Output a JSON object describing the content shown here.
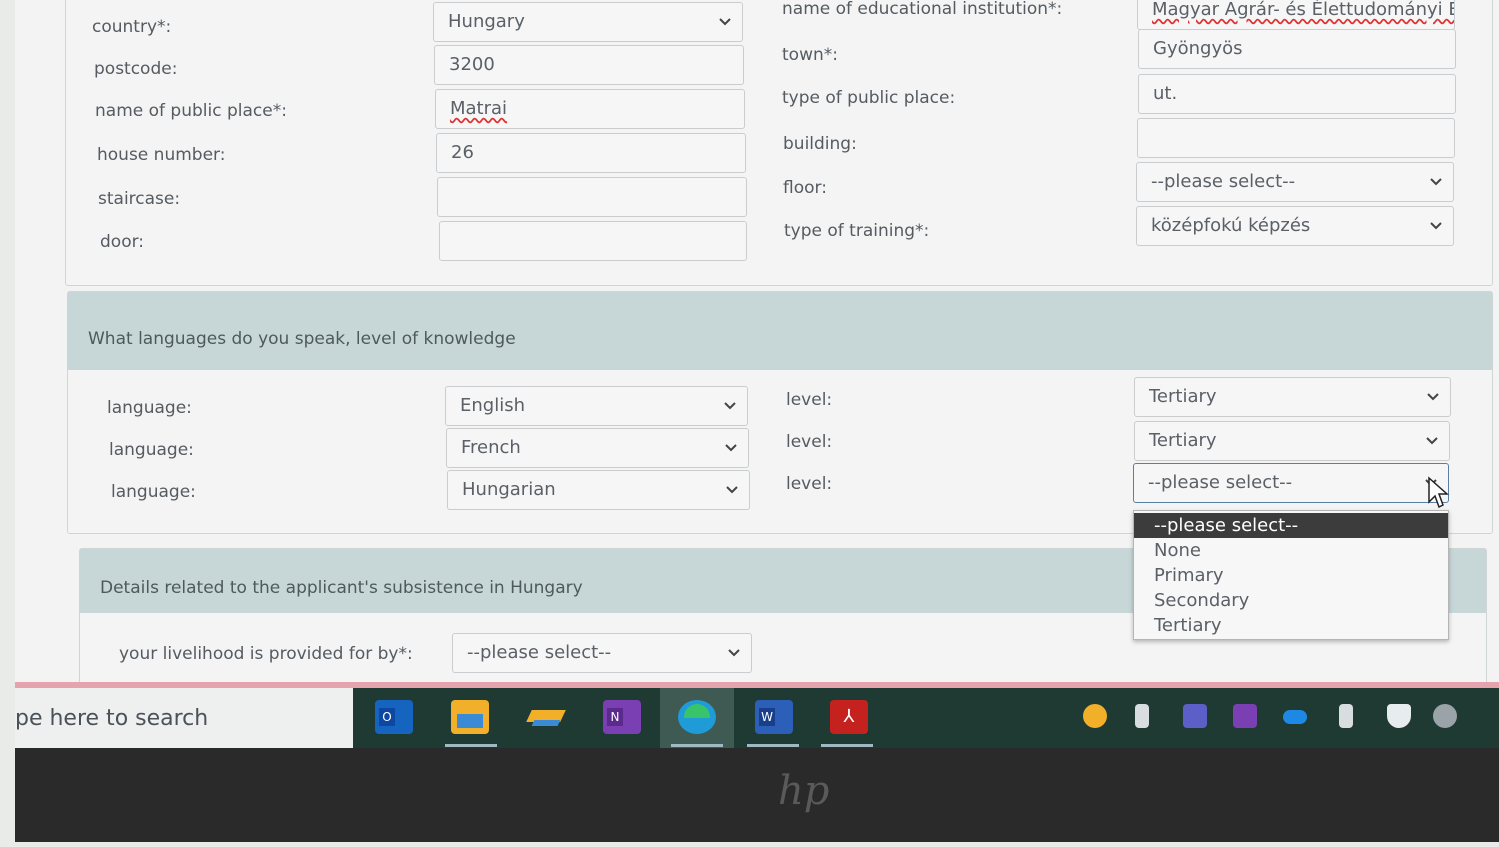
{
  "address": {
    "left": [
      {
        "label": "country*:",
        "value": "Hungary",
        "select": true
      },
      {
        "label": "postcode:",
        "value": "3200",
        "select": false
      },
      {
        "label": "name of public place*:",
        "value": "Matrai",
        "select": false
      },
      {
        "label": "house number:",
        "value": "26",
        "select": false
      },
      {
        "label": "staircase:",
        "value": "",
        "select": false
      },
      {
        "label": "door:",
        "value": "",
        "select": false
      }
    ],
    "right": [
      {
        "label": "name of educational institution*:",
        "value": "Magyar Agrár- és Élettudományi E",
        "select": false
      },
      {
        "label": "town*:",
        "value": "Gyöngyös",
        "select": false
      },
      {
        "label": "type of public place:",
        "value": "ut.",
        "select": false
      },
      {
        "label": "building:",
        "value": "",
        "select": false
      },
      {
        "label": "floor:",
        "value": "--please select--",
        "select": true
      },
      {
        "label": "type of training*:",
        "value": "középfokú képzés",
        "select": true
      }
    ]
  },
  "languages": {
    "title": "What languages do you speak, level of knowledge",
    "rows": [
      {
        "label": "language:",
        "language": "English",
        "level_label": "level:",
        "level": "Tertiary"
      },
      {
        "label": "language:",
        "language": "French",
        "level_label": "level:",
        "level": "Tertiary"
      },
      {
        "label": "language:",
        "language": "Hungarian",
        "level_label": "level:",
        "level": "--please select--"
      }
    ],
    "level_options": [
      "--please select--",
      "None",
      "Primary",
      "Secondary",
      "Tertiary"
    ]
  },
  "subsistence": {
    "title": "Details related to the applicant's subsistence in Hungary",
    "label": "your livelihood is provided for by*:",
    "value": "--please select--"
  },
  "taskbar": {
    "search_placeholder": "pe here to search",
    "apps": [
      "outlook-icon",
      "file-explorer-icon",
      "sticky-notes-icon",
      "onenote-icon",
      "edge-icon",
      "word-icon",
      "acrobat-icon"
    ],
    "tray": [
      "clock-app-icon",
      "battery-icon",
      "teams-icon",
      "onenote-tray-icon",
      "onedrive-icon",
      "usb-icon",
      "security-icon",
      "network-icon"
    ]
  },
  "colors": {
    "panel_header": "#c7d7d7",
    "taskbar": "#1f3a33",
    "dropdown_active": "#3c3c3c",
    "accent_underline": "#e5a3ad"
  }
}
